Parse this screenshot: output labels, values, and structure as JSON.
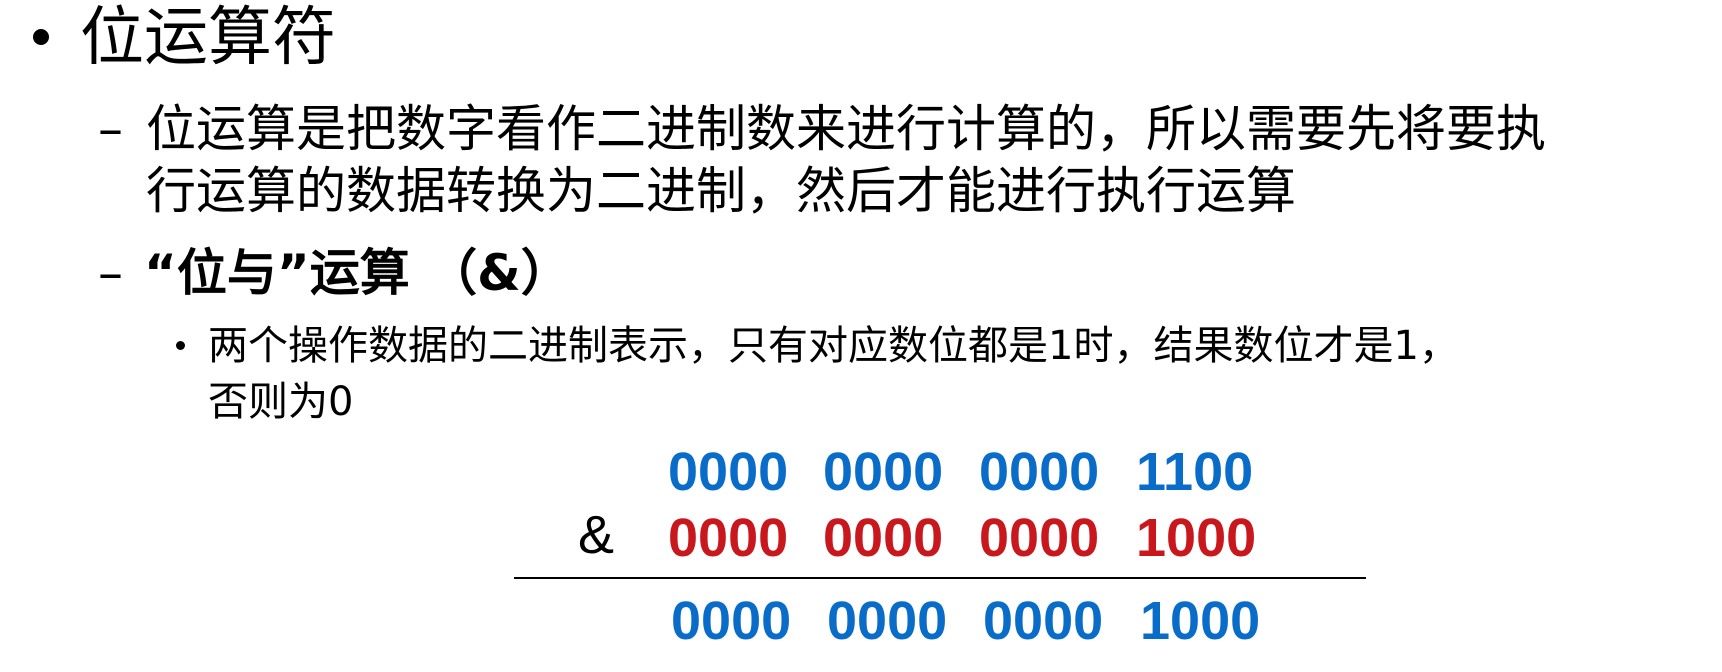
{
  "colors": {
    "text": "#000000",
    "blue": "#0a6cc9",
    "red": "#c8171d"
  },
  "heading": {
    "bullet": "•",
    "title": "位运算符"
  },
  "item1": {
    "dash": "–",
    "line1": "位运算是把数字看作二进制数来进行计算的，所以需要先将要执",
    "line2": "行运算的数据转换为二进制，然后才能进行执行运算"
  },
  "item2": {
    "dash": "–",
    "label": "“位与”运算 （&）"
  },
  "subitem": {
    "bullet": "•",
    "line1": "两个操作数据的二进制表示，只有对应数位都是1时，结果数位才是1，",
    "line2": "否则为0"
  },
  "example": {
    "operator": "&",
    "operand_a": [
      "0000",
      "0000",
      "0000",
      "1100"
    ],
    "operand_b": [
      "0000",
      "0000",
      "0000",
      "1000"
    ],
    "result": [
      "0000",
      "0000",
      "0000",
      "1000"
    ]
  }
}
